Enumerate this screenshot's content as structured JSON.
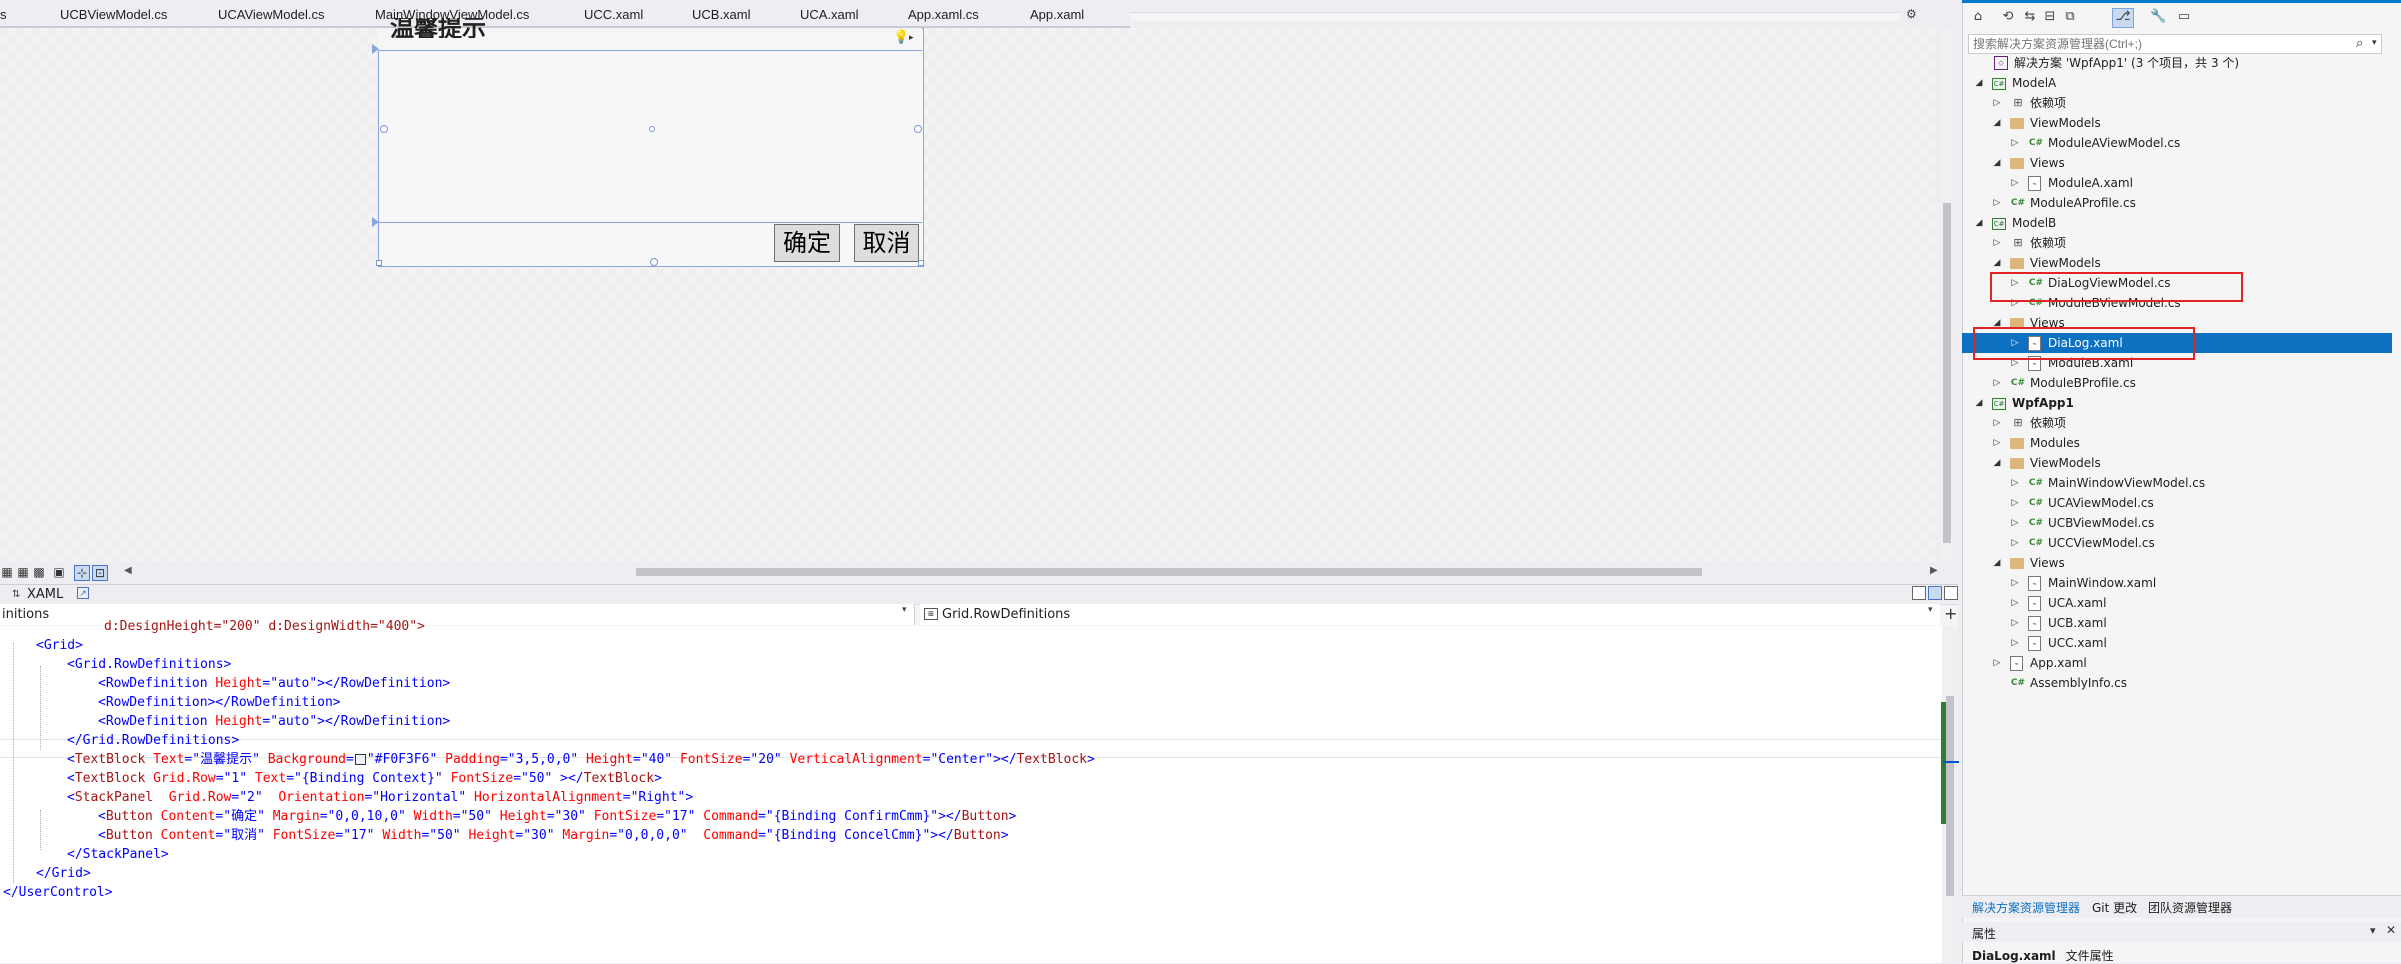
{
  "tabs": [
    "s",
    "UCBViewModel.cs",
    "UCAViewModel.cs",
    "MainWindowViewModel.cs",
    "UCC.xaml",
    "UCB.xaml",
    "UCA.xaml",
    "App.xaml.cs",
    "App.xaml"
  ],
  "designer": {
    "title_partial": "温馨提示",
    "confirm_button": "确定",
    "cancel_button": "取消"
  },
  "xaml_tab": {
    "label": "XAML"
  },
  "nav": {
    "left": "initions",
    "right": "Grid.RowDefinitions"
  },
  "code": {
    "line0": "d:DesignHeight=\"200\" d:DesignWidth=\"400\">",
    "grid_open": "<Grid>",
    "rowdefs_open": "<Grid.RowDefinitions>",
    "rowdef1_tag": "<RowDefinition",
    "rowdef1_attr": "Height",
    "rowdef1_val": "\"auto\"",
    "rowdef1_end": "></RowDefinition>",
    "rowdef2": "<RowDefinition></RowDefinition>",
    "rowdef3_val": "\"auto\"",
    "rowdefs_close": "</Grid.RowDefinitions>",
    "tb1_text": "\"温馨提示\"",
    "tb1_bg": "\"#F0F3F6\"",
    "tb1_padding": "\"3,5,0,0\"",
    "tb1_height": "\"40\"",
    "tb1_fontsize": "\"20\"",
    "tb1_valign": "\"Center\"",
    "tb2_row": "\"1\"",
    "tb2_text": "\"{Binding Context}\"",
    "tb2_fontsize": "\"50\"",
    "sp_row": "\"2\"",
    "sp_orient": "\"Horizontal\"",
    "sp_halign": "\"Right\"",
    "btn1_content": "\"确定\"",
    "btn1_margin": "\"0,0,10,0\"",
    "btn1_width": "\"50\"",
    "btn1_height": "\"30\"",
    "btn1_fontsize": "\"17\"",
    "btn1_command": "\"{Binding ConfirmCmm}\"",
    "btn2_content": "\"取消\"",
    "btn2_fontsize": "\"17\"",
    "btn2_width": "\"50\"",
    "btn2_height": "\"30\"",
    "btn2_margin": "\"0,0,0,0\"",
    "btn2_command": "\"{Binding ConcelCmm}\"",
    "sp_close": "</StackPanel>",
    "grid_close": "</Grid>",
    "uc_close": "</UserControl>"
  },
  "solution_explorer": {
    "search_placeholder": "搜索解决方案资源管理器(Ctrl+;)",
    "items": [
      {
        "label": "解决方案 'WpfApp1' (3 个项目，共 3 个)",
        "icon": "solution-icon"
      },
      {
        "label": "ModelA",
        "icon": "project-icon"
      },
      {
        "label": "依赖项",
        "icon": "dependencies-icon"
      },
      {
        "label": "ViewModels",
        "icon": "folder-icon"
      },
      {
        "label": "ModuleAViewModel.cs",
        "icon": "csharp-icon"
      },
      {
        "label": "Views",
        "icon": "folder-icon"
      },
      {
        "label": "ModuleA.xaml",
        "icon": "xaml-icon"
      },
      {
        "label": "ModuleAProfile.cs",
        "icon": "csharp-icon"
      },
      {
        "label": "ModelB",
        "icon": "project-icon"
      },
      {
        "label": "依赖项",
        "icon": "dependencies-icon"
      },
      {
        "label": "ViewModels",
        "icon": "folder-icon"
      },
      {
        "label": "DiaLogViewModel.cs",
        "icon": "csharp-icon"
      },
      {
        "label": "ModuleBViewModel.cs",
        "icon": "csharp-icon"
      },
      {
        "label": "Views",
        "icon": "folder-icon"
      },
      {
        "label": "DiaLog.xaml",
        "icon": "xaml-icon"
      },
      {
        "label": "ModuleB.xaml",
        "icon": "xaml-icon"
      },
      {
        "label": "ModuleBProfile.cs",
        "icon": "csharp-icon"
      },
      {
        "label": "WpfApp1",
        "icon": "project-icon"
      },
      {
        "label": "依赖项",
        "icon": "dependencies-icon"
      },
      {
        "label": "Modules",
        "icon": "folder-icon"
      },
      {
        "label": "ViewModels",
        "icon": "folder-icon"
      },
      {
        "label": "MainWindowViewModel.cs",
        "icon": "csharp-icon"
      },
      {
        "label": "UCAViewModel.cs",
        "icon": "csharp-icon"
      },
      {
        "label": "UCBViewModel.cs",
        "icon": "csharp-icon"
      },
      {
        "label": "UCCViewModel.cs",
        "icon": "csharp-icon"
      },
      {
        "label": "Views",
        "icon": "folder-icon"
      },
      {
        "label": "MainWindow.xaml",
        "icon": "xaml-icon"
      },
      {
        "label": "UCA.xaml",
        "icon": "xaml-icon"
      },
      {
        "label": "UCB.xaml",
        "icon": "xaml-icon"
      },
      {
        "label": "UCC.xaml",
        "icon": "xaml-icon"
      },
      {
        "label": "App.xaml",
        "icon": "xaml-icon"
      },
      {
        "label": "AssemblyInfo.cs",
        "icon": "csharp-icon"
      }
    ],
    "selected_item": "DiaLog.xaml",
    "bottom_tabs": [
      "解决方案资源管理器",
      "Git 更改",
      "团队资源管理器"
    ]
  },
  "properties": {
    "title": "属性",
    "object_name": "DiaLog.xaml",
    "object_type": "文件属性"
  },
  "colors": {
    "selection": "#0e70c0",
    "highlight_box": "#e32424",
    "accent": "#007acc"
  }
}
